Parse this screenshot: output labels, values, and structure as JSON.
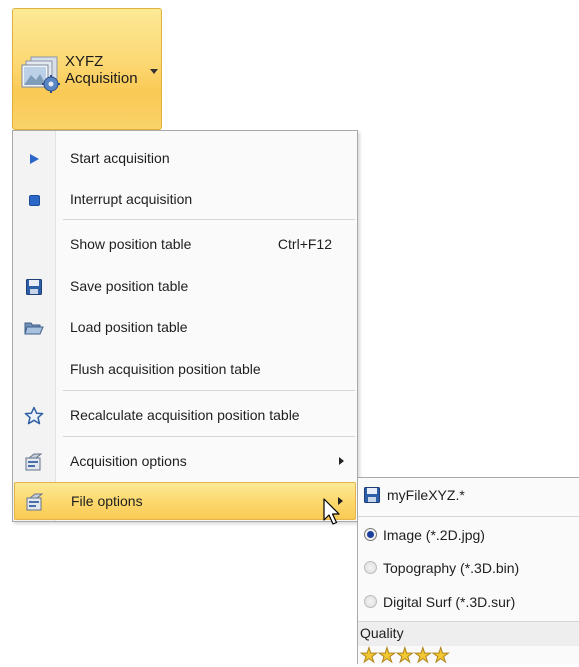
{
  "ribbon": {
    "button_line1": "XYFZ",
    "button_line2": "Acquisition",
    "icon": "image-stack-gear-icon"
  },
  "menu": {
    "items": [
      {
        "label": "Start acquisition",
        "icon": "play-icon"
      },
      {
        "label": "Interrupt acquisition",
        "icon": "stop-icon"
      },
      {
        "label": "Show position table",
        "shortcut": "Ctrl+F12"
      },
      {
        "label": "Save position table",
        "icon": "save-icon"
      },
      {
        "label": "Load position table",
        "icon": "folder-open-icon"
      },
      {
        "label": "Flush acquisition position table"
      },
      {
        "label": "Recalculate acquisition position table",
        "icon": "star-outline-icon"
      },
      {
        "label": "Acquisition options",
        "icon": "options-icon",
        "has_submenu": true
      },
      {
        "label": "File options",
        "icon": "options-icon",
        "has_submenu": true,
        "highlighted": true
      }
    ]
  },
  "submenu": {
    "filename": "myFileXYZ.*",
    "formats": [
      {
        "label": "Image (*.2D.jpg)",
        "selected": true
      },
      {
        "label": "Topography (*.3D.bin)",
        "selected": false
      },
      {
        "label": "Digital Surf (*.3D.sur)",
        "selected": false
      }
    ],
    "quality_label": "Quality",
    "quality_stars": 5
  },
  "colors": {
    "highlight_top": "#fde996",
    "highlight_bottom": "#f9cb55",
    "accent_blue": "#2b67c6"
  }
}
